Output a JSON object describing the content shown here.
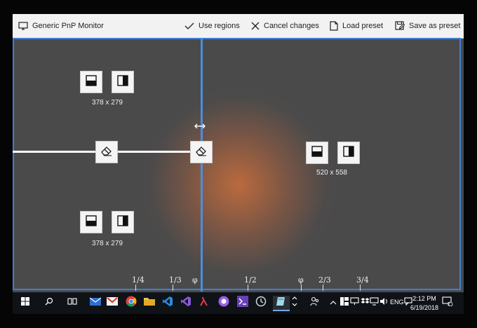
{
  "toolbar": {
    "monitor_name": "Generic PnP Monitor",
    "use_regions": "Use regions",
    "cancel_changes": "Cancel changes",
    "load_preset": "Load preset",
    "save_preset": "Save as preset"
  },
  "regions": [
    {
      "size": "378 x 279"
    },
    {
      "size": "378 x 279"
    },
    {
      "size": "520 x 558"
    }
  ],
  "ruler": {
    "ticks": [
      "1/4",
      "1/3",
      "φ",
      "1/2",
      "φ",
      "2/3",
      "3/4"
    ]
  },
  "taskbar": {
    "language": "ENG",
    "time": "2:12 PM",
    "date": "6/19/2018",
    "notification_count": "2"
  },
  "colors": {
    "accent": "#3f7fd6",
    "toolbar_bg": "#f2f2f2",
    "desktop_bg": "#4a4a4a",
    "taskbar_bg": "#0f1318"
  }
}
